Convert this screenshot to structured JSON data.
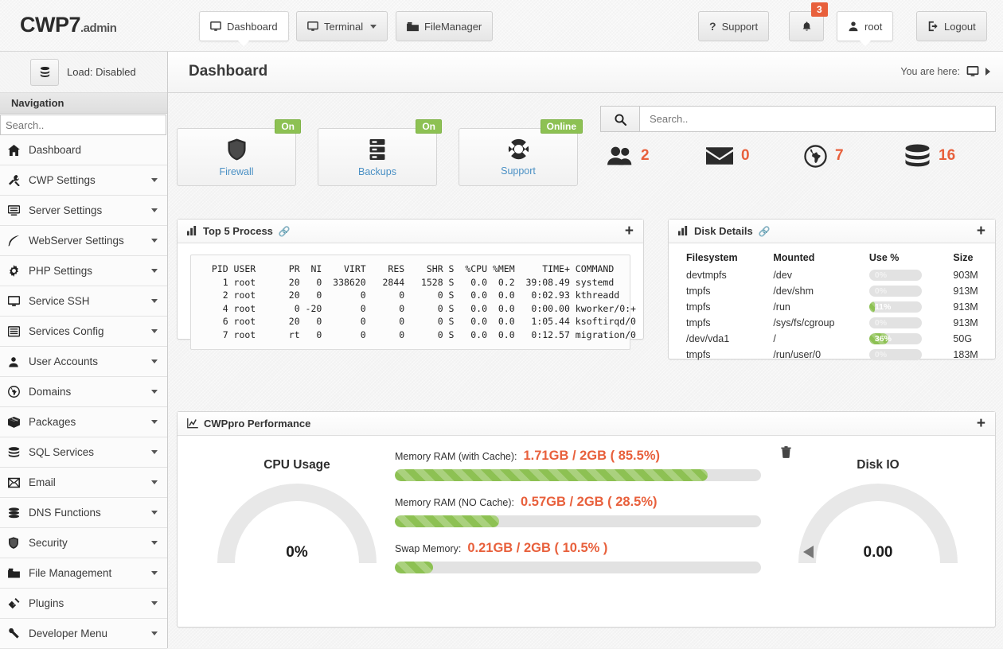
{
  "header": {
    "brand_main": "CWP7",
    "brand_suffix": ".admin",
    "nav": [
      {
        "label": "Dashboard",
        "icon": "monitor-icon",
        "active": true,
        "caret": false
      },
      {
        "label": "Terminal",
        "icon": "monitor-icon",
        "active": false,
        "caret": true
      },
      {
        "label": "FileManager",
        "icon": "folder-icon",
        "active": false,
        "caret": false
      }
    ],
    "support_label": "Support",
    "bell_badge": "3",
    "user_label": "root",
    "logout_label": "Logout"
  },
  "sidebar": {
    "load_label": "Load: Disabled",
    "load_icon": "database-icon",
    "nav_header": "Navigation",
    "search_placeholder": "Search..",
    "search_value": "",
    "items": [
      {
        "label": "Dashboard",
        "icon": "home-icon",
        "caret": false
      },
      {
        "label": "CWP Settings",
        "icon": "tools-icon",
        "caret": true
      },
      {
        "label": "Server Settings",
        "icon": "server-icon",
        "caret": true
      },
      {
        "label": "WebServer Settings",
        "icon": "feather-icon",
        "caret": true
      },
      {
        "label": "PHP Settings",
        "icon": "gear-icon",
        "caret": true
      },
      {
        "label": "Service SSH",
        "icon": "monitor-icon",
        "caret": true
      },
      {
        "label": "Services Config",
        "icon": "list-icon",
        "caret": true
      },
      {
        "label": "User Accounts",
        "icon": "user-icon",
        "caret": true
      },
      {
        "label": "Domains",
        "icon": "globe-icon",
        "caret": true
      },
      {
        "label": "Packages",
        "icon": "box-icon",
        "caret": true
      },
      {
        "label": "SQL Services",
        "icon": "database-icon",
        "caret": true
      },
      {
        "label": "Email",
        "icon": "envelope-icon",
        "caret": true
      },
      {
        "label": "DNS Functions",
        "icon": "layers-icon",
        "caret": true
      },
      {
        "label": "Security",
        "icon": "shield-icon",
        "caret": true
      },
      {
        "label": "File Management",
        "icon": "folder-icon",
        "caret": true
      },
      {
        "label": "Plugins",
        "icon": "plug-icon",
        "caret": true
      },
      {
        "label": "Developer Menu",
        "icon": "wrench-icon",
        "caret": true
      }
    ]
  },
  "page": {
    "title": "Dashboard",
    "breadcrumb_label": "You are here:",
    "breadcrumb_icon": "monitor-icon"
  },
  "search": {
    "placeholder": "Search..",
    "value": "",
    "icon": "search-icon"
  },
  "tiles": [
    {
      "label": "Firewall",
      "badge": "On",
      "icon": "shield-icon"
    },
    {
      "label": "Backups",
      "badge": "On",
      "icon": "server-rack-icon"
    },
    {
      "label": "Support",
      "badge": "Online",
      "icon": "lifebuoy-icon"
    }
  ],
  "counters": [
    {
      "icon": "users-icon",
      "value": "2"
    },
    {
      "icon": "envelope-icon",
      "value": "0"
    },
    {
      "icon": "globe-icon",
      "value": "7"
    },
    {
      "icon": "database-icon",
      "value": "16"
    }
  ],
  "top5": {
    "title": "Top 5 Process",
    "icon": "bar-chart-icon",
    "link_icon": "link-icon",
    "plus": "+",
    "columns": "  PID USER      PR  NI    VIRT    RES    SHR S  %CPU %MEM     TIME+ COMMAND",
    "rows": [
      "    1 root      20   0  338620   2844   1528 S   0.0  0.2  39:08.49 systemd",
      "    2 root      20   0       0      0      0 S   0.0  0.0   0:02.93 kthreadd",
      "    4 root       0 -20       0      0      0 S   0.0  0.0   0:00.00 kworker/0:+",
      "    6 root      20   0       0      0      0 S   0.0  0.0   1:05.44 ksoftirqd/0",
      "    7 root      rt   0       0      0      0 S   0.0  0.0   0:12.57 migration/0"
    ]
  },
  "disk": {
    "title": "Disk Details",
    "icon": "bar-chart-icon",
    "link_icon": "link-icon",
    "plus": "+",
    "columns": [
      "Filesystem",
      "Mounted",
      "Use %",
      "Size"
    ],
    "rows": [
      {
        "filesystem": "devtmpfs",
        "mounted": "/dev",
        "use": "0%",
        "use_pct": 0,
        "size": "903M"
      },
      {
        "filesystem": "tmpfs",
        "mounted": "/dev/shm",
        "use": "0%",
        "use_pct": 0,
        "size": "913M"
      },
      {
        "filesystem": "tmpfs",
        "mounted": "/run",
        "use": "11%",
        "use_pct": 11,
        "size": "913M"
      },
      {
        "filesystem": "tmpfs",
        "mounted": "/sys/fs/cgroup",
        "use": "0%",
        "use_pct": 0,
        "size": "913M"
      },
      {
        "filesystem": "/dev/vda1",
        "mounted": "/",
        "use": "36%",
        "use_pct": 36,
        "size": "50G"
      },
      {
        "filesystem": "tmpfs",
        "mounted": "/run/user/0",
        "use": "0%",
        "use_pct": 0,
        "size": "183M"
      }
    ]
  },
  "performance": {
    "title": "CWPpro Performance",
    "icon": "line-chart-icon",
    "plus": "+",
    "cpu_gauge": {
      "title": "CPU Usage",
      "value": "0%",
      "pct": 0
    },
    "disk_gauge": {
      "title": "Disk IO",
      "value": "0.00",
      "min_tick": "0",
      "max_tick": "15",
      "pct": 0
    },
    "memory": [
      {
        "label": "Memory RAM (with Cache):",
        "value": "1.71GB / 2GB ( 85.5%)",
        "pct": 85.5,
        "trash": true
      },
      {
        "label": "Memory RAM (NO Cache):",
        "value": "0.57GB / 2GB ( 28.5%)",
        "pct": 28.5,
        "trash": false
      },
      {
        "label": "Swap Memory:",
        "value": "0.21GB / 2GB ( 10.5% )",
        "pct": 10.5,
        "trash": false
      }
    ]
  },
  "colors": {
    "accent_orange": "#e8603c",
    "accent_green": "#8dc153",
    "link_blue": "#4a90c4"
  }
}
